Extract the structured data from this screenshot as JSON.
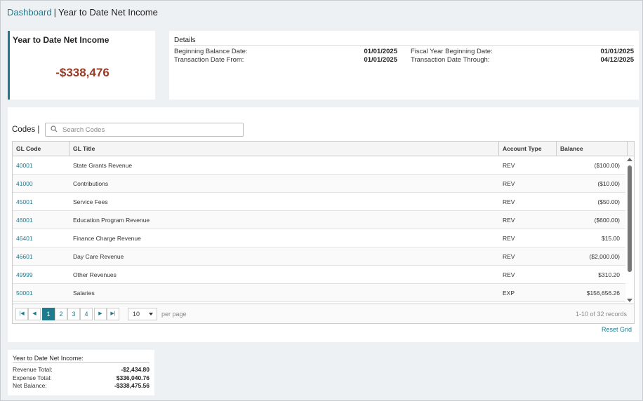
{
  "breadcrumb": {
    "link": "Dashboard",
    "separator": "|",
    "current": "Year to Date Net Income"
  },
  "net_income_card": {
    "title": "Year to Date Net Income",
    "amount": "-$338,476",
    "accent_color": "#1f7a8c",
    "amount_color": "#9a3b24"
  },
  "details": {
    "title": "Details",
    "beginning_balance_date_label": "Beginning Balance Date:",
    "beginning_balance_date_value": "01/01/2025",
    "transaction_date_from_label": "Transaction Date From:",
    "transaction_date_from_value": "01/01/2025",
    "fiscal_year_beginning_label": "Fiscal Year Beginning Date:",
    "fiscal_year_beginning_value": "01/01/2025",
    "transaction_date_through_label": "Transaction Date Through:",
    "transaction_date_through_value": "04/12/2025"
  },
  "codes": {
    "label": "Codes |",
    "search_placeholder": "Search Codes"
  },
  "table": {
    "headers": {
      "gl_code": "GL Code",
      "gl_title": "GL Title",
      "account_type": "Account Type",
      "balance": "Balance"
    },
    "rows": [
      {
        "gl_code": "40001",
        "gl_title": "State Grants Revenue",
        "account_type": "REV",
        "balance": "($100.00)"
      },
      {
        "gl_code": "41000",
        "gl_title": "Contributions",
        "account_type": "REV",
        "balance": "($10.00)"
      },
      {
        "gl_code": "45001",
        "gl_title": "Service Fees",
        "account_type": "REV",
        "balance": "($50.00)"
      },
      {
        "gl_code": "46001",
        "gl_title": "Education Program Revenue",
        "account_type": "REV",
        "balance": "($600.00)"
      },
      {
        "gl_code": "46401",
        "gl_title": "Finance Charge Revenue",
        "account_type": "REV",
        "balance": "$15.00"
      },
      {
        "gl_code": "46601",
        "gl_title": "Day Care Revenue",
        "account_type": "REV",
        "balance": "($2,000.00)"
      },
      {
        "gl_code": "49999",
        "gl_title": "Other Revenues",
        "account_type": "REV",
        "balance": "$310.20"
      },
      {
        "gl_code": "50001",
        "gl_title": "Salaries",
        "account_type": "EXP",
        "balance": "$156,656.26"
      }
    ]
  },
  "pager": {
    "first_icon": "first-page-icon",
    "prev_icon": "prev-page-icon",
    "next_icon": "next-page-icon",
    "last_icon": "last-page-icon",
    "pages": [
      "1",
      "2",
      "3",
      "4"
    ],
    "active_page": "1",
    "page_size": "10",
    "per_page_label": "per page",
    "records_text": "1-10 of 32 records"
  },
  "reset_grid": "Reset Grid",
  "summary": {
    "title": "Year to Date Net Income:",
    "revenue_label": "Revenue Total:",
    "revenue_value": "-$2,434.80",
    "expense_label": "Expense Total:",
    "expense_value": "$336,040.76",
    "net_label": "Net Balance:",
    "net_value": "-$338,475.56"
  }
}
